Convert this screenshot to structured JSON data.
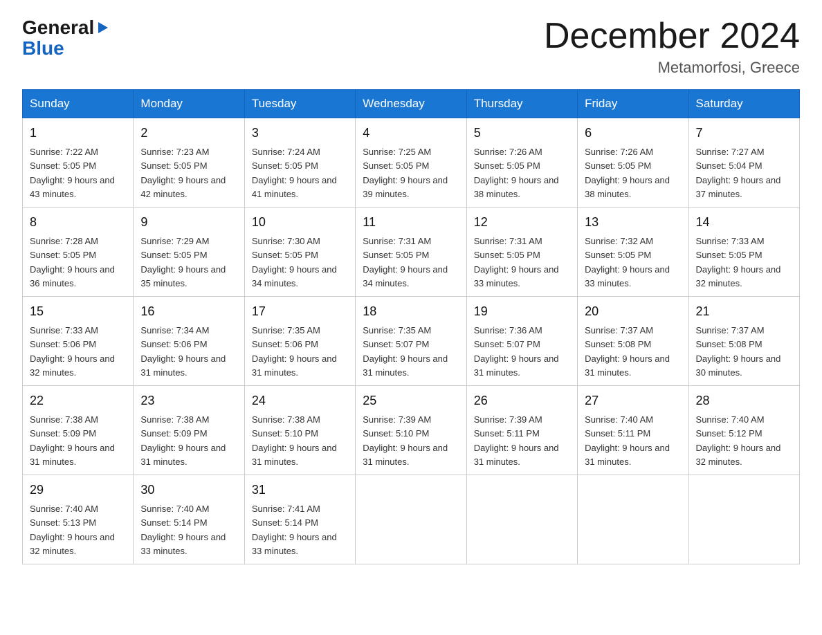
{
  "logo": {
    "general": "General",
    "blue": "Blue"
  },
  "title": "December 2024",
  "subtitle": "Metamorfosi, Greece",
  "days_of_week": [
    "Sunday",
    "Monday",
    "Tuesday",
    "Wednesday",
    "Thursday",
    "Friday",
    "Saturday"
  ],
  "weeks": [
    [
      {
        "day": "1",
        "sunrise": "7:22 AM",
        "sunset": "5:05 PM",
        "daylight": "9 hours and 43 minutes."
      },
      {
        "day": "2",
        "sunrise": "7:23 AM",
        "sunset": "5:05 PM",
        "daylight": "9 hours and 42 minutes."
      },
      {
        "day": "3",
        "sunrise": "7:24 AM",
        "sunset": "5:05 PM",
        "daylight": "9 hours and 41 minutes."
      },
      {
        "day": "4",
        "sunrise": "7:25 AM",
        "sunset": "5:05 PM",
        "daylight": "9 hours and 39 minutes."
      },
      {
        "day": "5",
        "sunrise": "7:26 AM",
        "sunset": "5:05 PM",
        "daylight": "9 hours and 38 minutes."
      },
      {
        "day": "6",
        "sunrise": "7:26 AM",
        "sunset": "5:05 PM",
        "daylight": "9 hours and 38 minutes."
      },
      {
        "day": "7",
        "sunrise": "7:27 AM",
        "sunset": "5:04 PM",
        "daylight": "9 hours and 37 minutes."
      }
    ],
    [
      {
        "day": "8",
        "sunrise": "7:28 AM",
        "sunset": "5:05 PM",
        "daylight": "9 hours and 36 minutes."
      },
      {
        "day": "9",
        "sunrise": "7:29 AM",
        "sunset": "5:05 PM",
        "daylight": "9 hours and 35 minutes."
      },
      {
        "day": "10",
        "sunrise": "7:30 AM",
        "sunset": "5:05 PM",
        "daylight": "9 hours and 34 minutes."
      },
      {
        "day": "11",
        "sunrise": "7:31 AM",
        "sunset": "5:05 PM",
        "daylight": "9 hours and 34 minutes."
      },
      {
        "day": "12",
        "sunrise": "7:31 AM",
        "sunset": "5:05 PM",
        "daylight": "9 hours and 33 minutes."
      },
      {
        "day": "13",
        "sunrise": "7:32 AM",
        "sunset": "5:05 PM",
        "daylight": "9 hours and 33 minutes."
      },
      {
        "day": "14",
        "sunrise": "7:33 AM",
        "sunset": "5:05 PM",
        "daylight": "9 hours and 32 minutes."
      }
    ],
    [
      {
        "day": "15",
        "sunrise": "7:33 AM",
        "sunset": "5:06 PM",
        "daylight": "9 hours and 32 minutes."
      },
      {
        "day": "16",
        "sunrise": "7:34 AM",
        "sunset": "5:06 PM",
        "daylight": "9 hours and 31 minutes."
      },
      {
        "day": "17",
        "sunrise": "7:35 AM",
        "sunset": "5:06 PM",
        "daylight": "9 hours and 31 minutes."
      },
      {
        "day": "18",
        "sunrise": "7:35 AM",
        "sunset": "5:07 PM",
        "daylight": "9 hours and 31 minutes."
      },
      {
        "day": "19",
        "sunrise": "7:36 AM",
        "sunset": "5:07 PM",
        "daylight": "9 hours and 31 minutes."
      },
      {
        "day": "20",
        "sunrise": "7:37 AM",
        "sunset": "5:08 PM",
        "daylight": "9 hours and 31 minutes."
      },
      {
        "day": "21",
        "sunrise": "7:37 AM",
        "sunset": "5:08 PM",
        "daylight": "9 hours and 30 minutes."
      }
    ],
    [
      {
        "day": "22",
        "sunrise": "7:38 AM",
        "sunset": "5:09 PM",
        "daylight": "9 hours and 31 minutes."
      },
      {
        "day": "23",
        "sunrise": "7:38 AM",
        "sunset": "5:09 PM",
        "daylight": "9 hours and 31 minutes."
      },
      {
        "day": "24",
        "sunrise": "7:38 AM",
        "sunset": "5:10 PM",
        "daylight": "9 hours and 31 minutes."
      },
      {
        "day": "25",
        "sunrise": "7:39 AM",
        "sunset": "5:10 PM",
        "daylight": "9 hours and 31 minutes."
      },
      {
        "day": "26",
        "sunrise": "7:39 AM",
        "sunset": "5:11 PM",
        "daylight": "9 hours and 31 minutes."
      },
      {
        "day": "27",
        "sunrise": "7:40 AM",
        "sunset": "5:11 PM",
        "daylight": "9 hours and 31 minutes."
      },
      {
        "day": "28",
        "sunrise": "7:40 AM",
        "sunset": "5:12 PM",
        "daylight": "9 hours and 32 minutes."
      }
    ],
    [
      {
        "day": "29",
        "sunrise": "7:40 AM",
        "sunset": "5:13 PM",
        "daylight": "9 hours and 32 minutes."
      },
      {
        "day": "30",
        "sunrise": "7:40 AM",
        "sunset": "5:14 PM",
        "daylight": "9 hours and 33 minutes."
      },
      {
        "day": "31",
        "sunrise": "7:41 AM",
        "sunset": "5:14 PM",
        "daylight": "9 hours and 33 minutes."
      },
      null,
      null,
      null,
      null
    ]
  ]
}
